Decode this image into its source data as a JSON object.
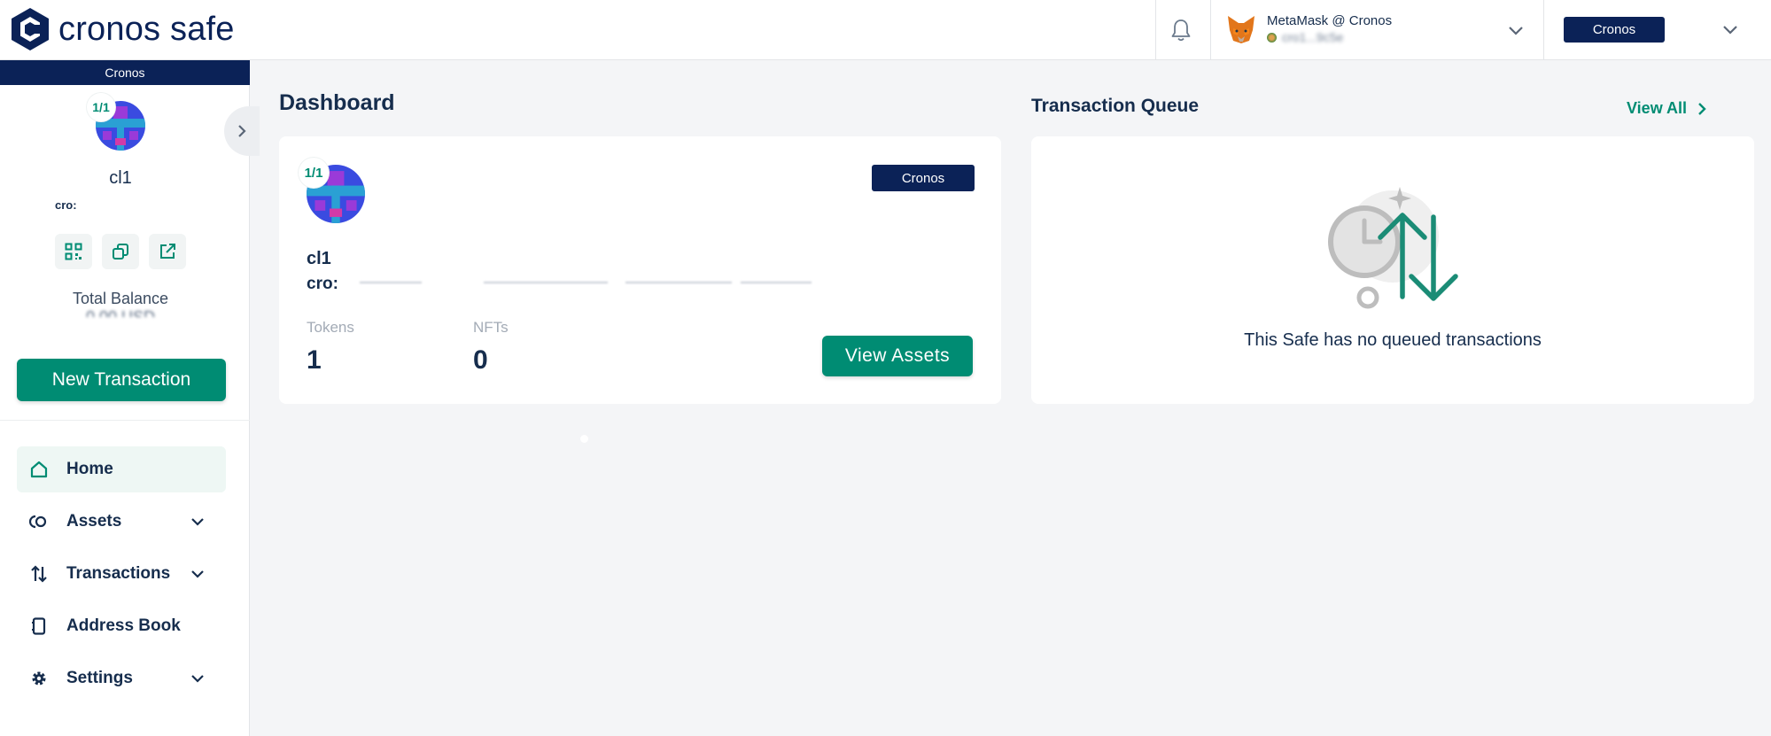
{
  "brand": {
    "name": "cronos safe",
    "logo_icon": "cronos-logo-icon",
    "color": "#0b2257",
    "accent": "#008c73"
  },
  "header": {
    "notifications_icon": "bell-icon",
    "wallet": {
      "name": "MetaMask @ Cronos",
      "address": "cro1...9c5e",
      "icon": "metamask-fox-icon"
    },
    "network": "Cronos"
  },
  "sidebar": {
    "network": "Cronos",
    "safe": {
      "threshold": "1/1",
      "name": "cl1",
      "address_prefix": "cro:"
    },
    "actions": [
      {
        "name": "qr-code-icon"
      },
      {
        "name": "copy-icon"
      },
      {
        "name": "external-link-icon"
      }
    ],
    "total_balance_label": "Total Balance",
    "total_balance_value": "0.00 USD",
    "new_transaction_label": "New Transaction",
    "nav": [
      {
        "label": "Home",
        "icon": "home-icon",
        "active": true,
        "expandable": false
      },
      {
        "label": "Assets",
        "icon": "assets-icon",
        "active": false,
        "expandable": true
      },
      {
        "label": "Transactions",
        "icon": "transactions-icon",
        "active": false,
        "expandable": true
      },
      {
        "label": "Address Book",
        "icon": "address-book-icon",
        "active": false,
        "expandable": false
      },
      {
        "label": "Settings",
        "icon": "settings-gear-icon",
        "active": false,
        "expandable": true
      }
    ]
  },
  "dashboard": {
    "title": "Dashboard",
    "safe_card": {
      "threshold": "1/1",
      "name": "cl1",
      "address_prefix": "cro:",
      "network": "Cronos",
      "tokens_label": "Tokens",
      "tokens_value": "1",
      "nfts_label": "NFTs",
      "nfts_value": "0",
      "view_assets_label": "View Assets"
    },
    "queue": {
      "title": "Transaction Queue",
      "view_all_label": "View All",
      "empty_text": "This Safe has no queued transactions"
    }
  }
}
